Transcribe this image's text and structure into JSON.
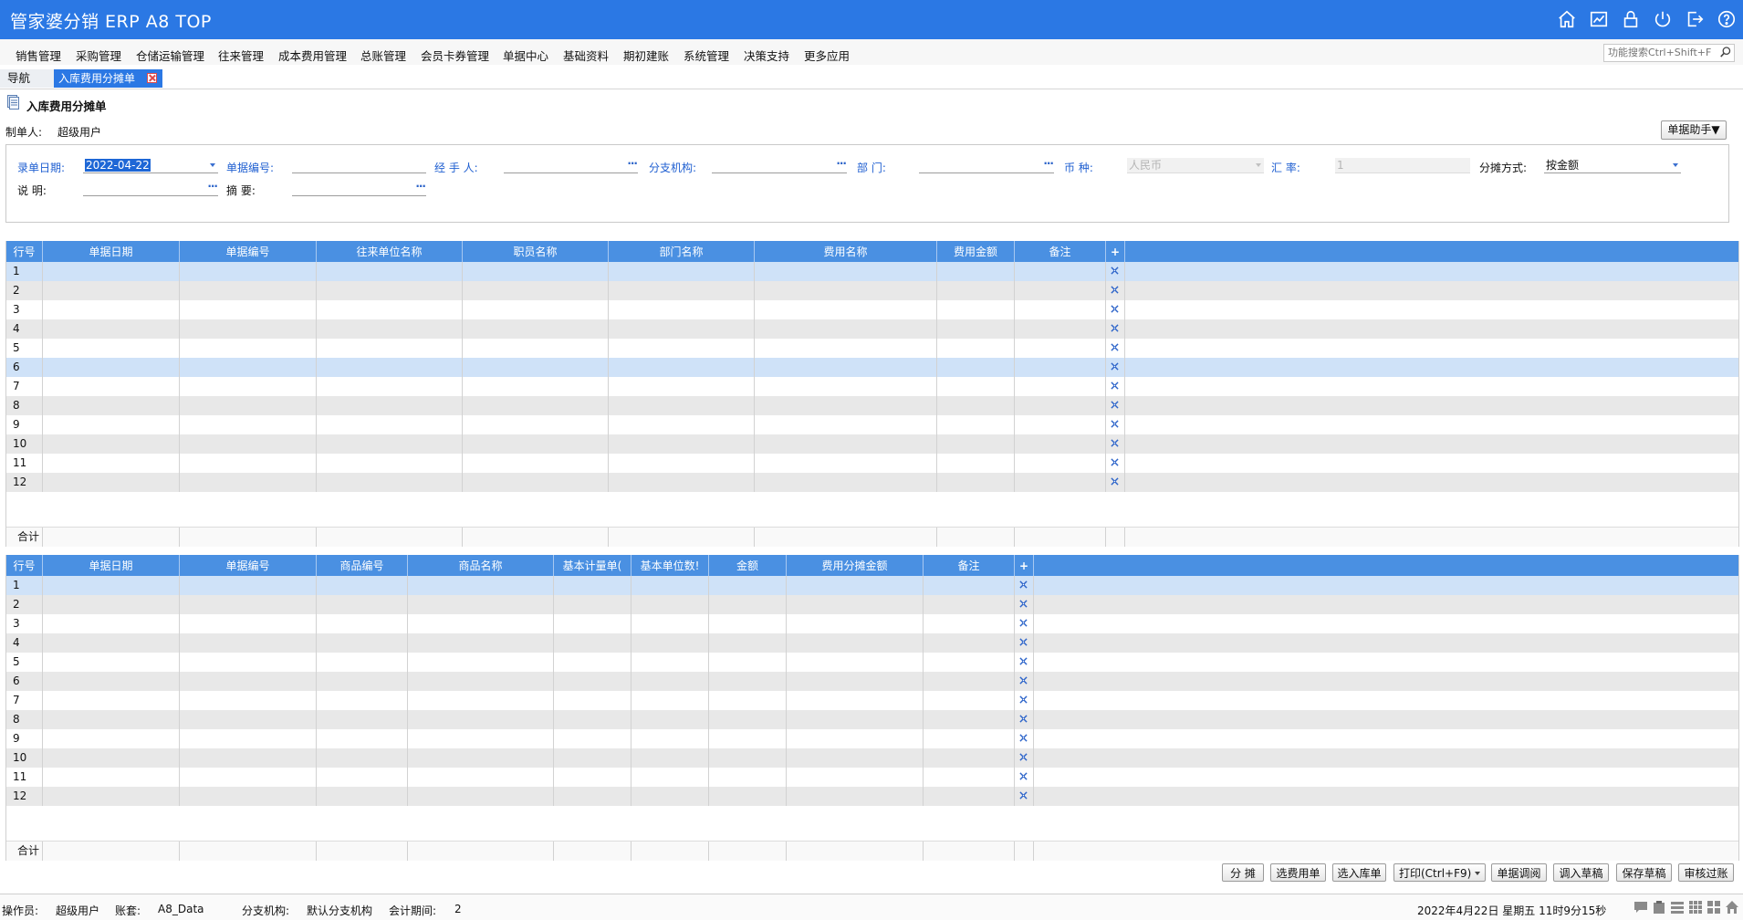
{
  "app": {
    "title": "管家婆分销 ERP A8 TOP"
  },
  "menu": [
    "销售管理",
    "采购管理",
    "仓储运输管理",
    "往来管理",
    "成本费用管理",
    "总账管理",
    "会员卡券管理",
    "单据中心",
    "基础资料",
    "期初建账",
    "系统管理",
    "决策支持",
    "更多应用"
  ],
  "search": {
    "placeholder": "功能搜索Ctrl+Shift+F"
  },
  "tabs": {
    "nav": "导航",
    "active": "入库费用分摊单"
  },
  "page": {
    "title": "入库费用分摊单",
    "maker_label": "制单人:",
    "maker_value": "超级用户",
    "helper_button": "单据助手▼"
  },
  "form": {
    "date_label": "录单日期:",
    "date_value": "2022-04-22",
    "docno_label": "单据编号:",
    "docno_value": "",
    "handler_label": "经  手  人:",
    "branch_label": "分支机构:",
    "dept_label": "部      门:",
    "currency_label": "币      种:",
    "currency_value": "人民币",
    "rate_label": "汇      率:",
    "rate_value": "1",
    "alloc_label": "分摊方式:",
    "alloc_value": "按金额",
    "desc_label": "说      明:",
    "summary_label": "摘      要:"
  },
  "grid1": {
    "columns": [
      "行号",
      "单据日期",
      "单据编号",
      "往来单位名称",
      "职员名称",
      "部门名称",
      "费用名称",
      "费用金额",
      "备注",
      "+"
    ],
    "rows": [
      "1",
      "2",
      "3",
      "4",
      "5",
      "6",
      "7",
      "8",
      "9",
      "10",
      "11",
      "12"
    ],
    "total_label": "合计"
  },
  "grid2": {
    "columns": [
      "行号",
      "单据日期",
      "单据编号",
      "商品编号",
      "商品名称",
      "基本计量单(",
      "基本单位数!",
      "金额",
      "费用分摊金额",
      "备注",
      "+"
    ],
    "rows": [
      "1",
      "2",
      "3",
      "4",
      "5",
      "6",
      "7",
      "8",
      "9",
      "10",
      "11",
      "12"
    ],
    "total_label": "合计"
  },
  "buttons": [
    "分  摊",
    "选费用单",
    "选入库单",
    "打印(Ctrl+F9)",
    "单据调阅",
    "调入草稿",
    "保存草稿",
    "审核过账"
  ],
  "status": {
    "operator_label": "操作员:",
    "operator_value": "超级用户",
    "account_label": "账套:",
    "account_value": "A8_Data",
    "branch_label": "分支机构:",
    "branch_value": "默认分支机构",
    "period_label": "会计期间:",
    "period_value": "2",
    "datetime": "2022年4月22日  星期五  11时9分15秒"
  },
  "colors": {
    "brand": "#2b78e4",
    "grid_header": "#4a90e2",
    "row_selected": "#cfe2f8",
    "row_alt": "#e8e8e8"
  },
  "icons": {
    "top": [
      "home-icon",
      "chart-icon",
      "lock-icon",
      "power-icon",
      "logout-icon",
      "help-icon"
    ],
    "status": [
      "chat-icon",
      "clipboard-icon",
      "list-icon",
      "grid-icon",
      "apps-icon",
      "home-icon"
    ]
  }
}
